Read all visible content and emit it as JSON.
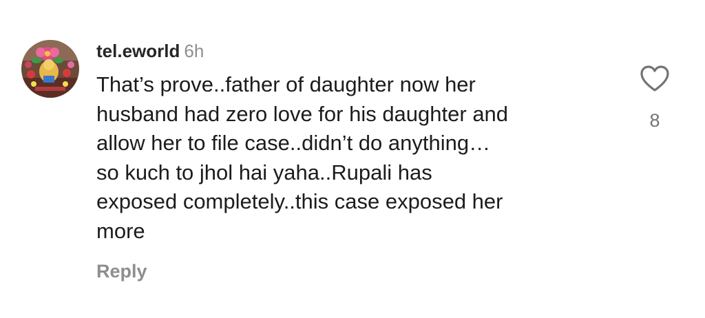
{
  "comment": {
    "username": "tel.eworld",
    "timestamp": "6h",
    "text_lines": [
      "That’s prove..father of daughter now her",
      "husband had zero love for his daughter and",
      "allow her to file case..didn’t do anything…",
      "so kuch to jhol hai yaha..Rupali has",
      "exposed completely..this case exposed her",
      "more"
    ],
    "reply_label": "Reply",
    "like_count": "8",
    "like_icon": "heart-outline-icon",
    "avatar_icon": "ganesha-idol-avatar"
  },
  "colors": {
    "text": "#1c1c1c",
    "muted": "#8e8e8e",
    "background": "#ffffff"
  }
}
